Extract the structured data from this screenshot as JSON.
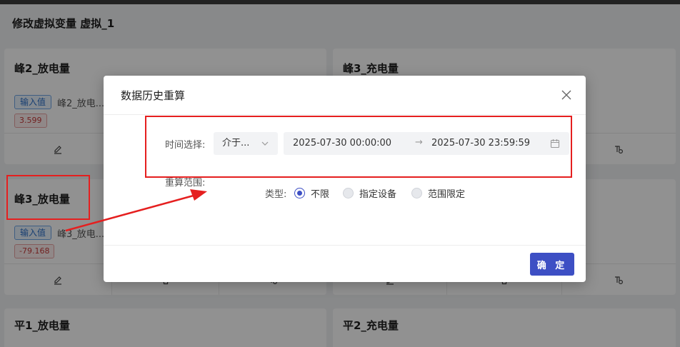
{
  "page": {
    "title": "修改虚拟变量 虚拟_1"
  },
  "cards": [
    {
      "title": "峰2_放电量",
      "tag": "输入值",
      "input": "峰2_放电...",
      "value": "3.599"
    },
    {
      "title": "峰3_充电量"
    },
    {
      "title": "峰3_放电量",
      "tag": "输入值",
      "input": "峰3_放电...",
      "value": "-79.168"
    },
    {
      "title": "平1_放电量"
    },
    {
      "title": "平2_充电量"
    }
  ],
  "modal": {
    "title": "数据历史重算",
    "time_label": "时间选择:",
    "select_value": "介于...",
    "range_start": "2025-07-30 00:00:00",
    "range_sep": "→",
    "range_end": "2025-07-30 23:59:59",
    "recalc_label": "重算范围:",
    "type_label": "类型:",
    "options": [
      "不限",
      "指定设备",
      "范围限定"
    ],
    "selected_option": "不限",
    "confirm_label": "确 定"
  },
  "colors": {
    "primary": "#3d4fc4",
    "annotation": "#e51f1f",
    "danger": "#c73a3a",
    "info": "#2a6fc9"
  },
  "icons": [
    "edit-icon",
    "trash-icon",
    "link-settings-icon",
    "close-icon",
    "calendar-icon",
    "chevron-down-icon",
    "arrow-icon"
  ]
}
